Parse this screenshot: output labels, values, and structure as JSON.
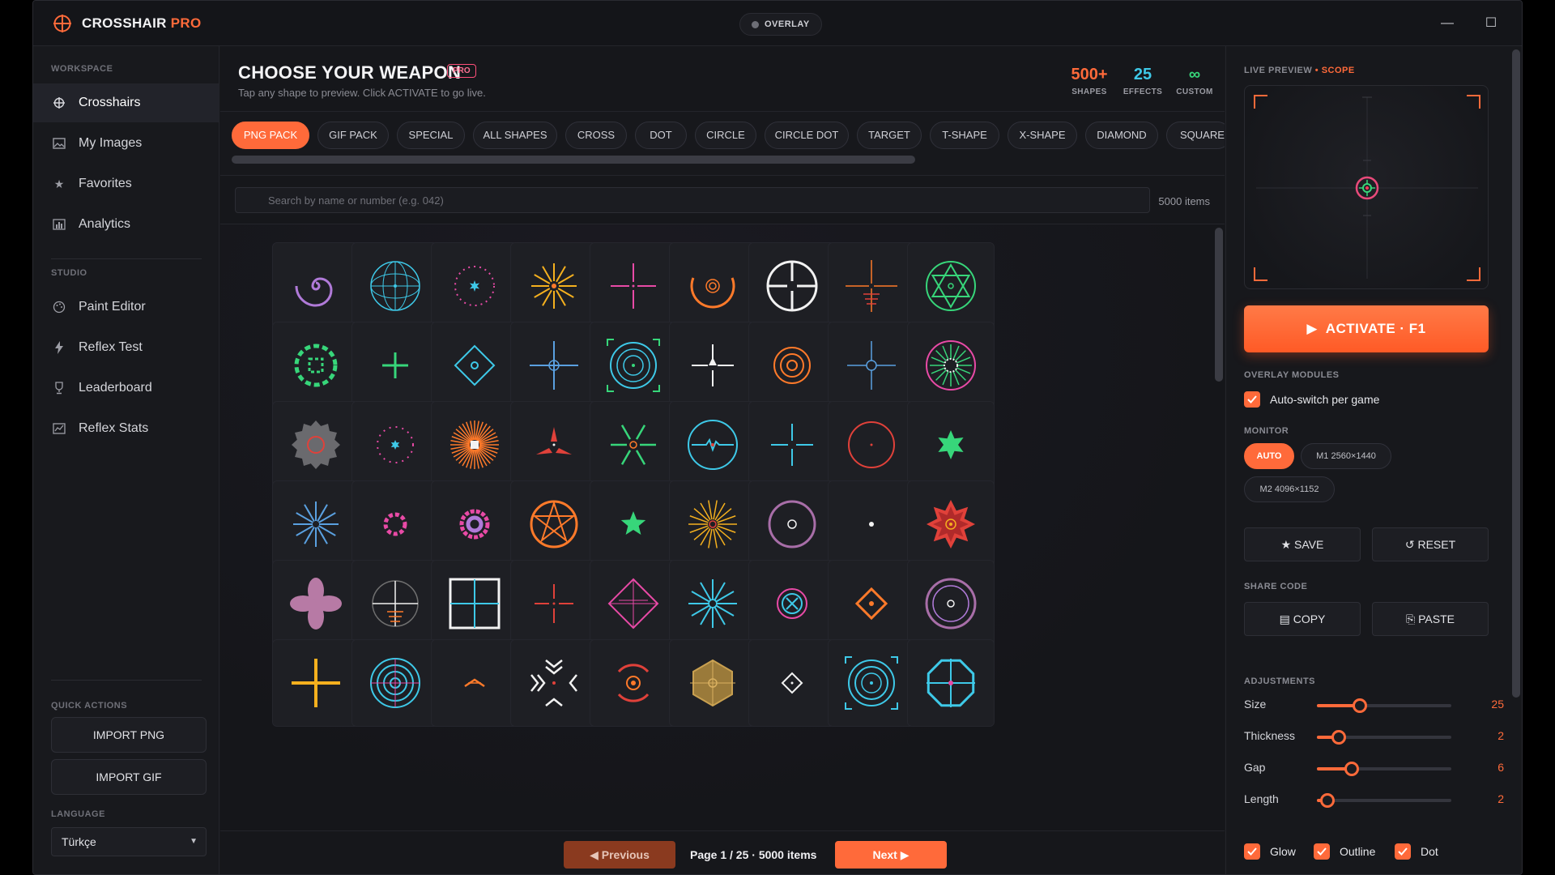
{
  "app": {
    "title_main": "CROSSHAIR",
    "title_accent": " PRO",
    "overlay_label": "OVERLAY"
  },
  "window_controls": {
    "minimize": "—",
    "maximize": "☐",
    "close": "✕"
  },
  "sidebar": {
    "workspace_label": "WORKSPACE",
    "workspace_items": [
      {
        "label": "Crosshairs",
        "icon": "crosshair-icon"
      },
      {
        "label": "My Images",
        "icon": "image-icon"
      },
      {
        "label": "Favorites",
        "icon": "star-icon"
      },
      {
        "label": "Analytics",
        "icon": "bar-chart-icon"
      }
    ],
    "studio_label": "STUDIO",
    "studio_items": [
      {
        "label": "Paint Editor",
        "icon": "palette-icon"
      },
      {
        "label": "Reflex Test",
        "icon": "lightning-icon"
      },
      {
        "label": "Leaderboard",
        "icon": "trophy-icon"
      },
      {
        "label": "Reflex Stats",
        "icon": "stats-icon"
      }
    ],
    "quick_actions_label": "QUICK ACTIONS",
    "import_png": "IMPORT PNG",
    "import_gif": "IMPORT GIF",
    "language_label": "LANGUAGE",
    "language_value": "Türkçe"
  },
  "main": {
    "title": "CHOOSE YOUR WEAPON",
    "badge": "PRO",
    "subtitle": "Tap any shape to preview. Click ACTIVATE to go live.",
    "stats": [
      {
        "value": "500+",
        "label": "SHAPES",
        "color": "#ff6a3a"
      },
      {
        "value": "25",
        "label": "EFFECTS",
        "color": "#3ec9e8"
      },
      {
        "value": "∞",
        "label": "CUSTOM",
        "color": "#37d67a"
      }
    ],
    "tabs": [
      "PNG PACK",
      "GIF PACK",
      "SPECIAL",
      "ALL SHAPES",
      "CROSS",
      "DOT",
      "CIRCLE",
      "CIRCLE DOT",
      "TARGET",
      "T-SHAPE",
      "X-SHAPE",
      "DIAMOND",
      "SQUARE"
    ],
    "search_placeholder": "Search by name or number (e.g. 042)",
    "item_count": "5000 items",
    "pager": {
      "prev": "Previous",
      "info": "Page 1 / 25  ·  5000 items",
      "next": "Next"
    }
  },
  "right": {
    "preview_label": "LIVE PREVIEW",
    "preview_mode": " • SCOPE",
    "activate": "ACTIVATE  ·  F1",
    "modules_label": "OVERLAY MODULES",
    "auto_switch": "Auto-switch per game",
    "monitor_label": "MONITOR",
    "monitors": [
      "AUTO",
      "M1  2560×1440",
      "M2  4096×1152"
    ],
    "save": "★ SAVE",
    "reset": "↺ RESET",
    "share_label": "SHARE CODE",
    "copy": "COPY",
    "paste": "PASTE",
    "adjust_label": "ADJUSTMENTS",
    "adjustments": [
      {
        "label": "Size",
        "value": "25",
        "fraction": 0.32
      },
      {
        "label": "Thickness",
        "value": "2",
        "fraction": 0.16
      },
      {
        "label": "Gap",
        "value": "6",
        "fraction": 0.26
      },
      {
        "label": "Length",
        "value": "2",
        "fraction": 0.08
      }
    ],
    "toggles": [
      "Glow",
      "Outline",
      "Dot"
    ]
  },
  "colors": {
    "accent": "#ff6a3a",
    "cyan": "#3ec9e8",
    "green": "#37d67a",
    "pink": "#e84aa6"
  }
}
